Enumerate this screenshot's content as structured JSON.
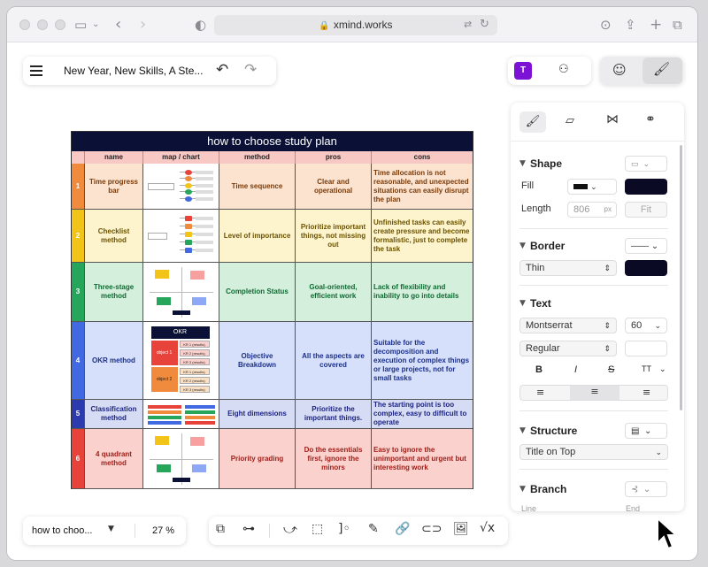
{
  "browser": {
    "url": "xmind.works"
  },
  "toolbar": {
    "doc_title": "New Year, New Skills, A Ste...",
    "user_badge": "T"
  },
  "sheet": {
    "title": "how to choose study plan",
    "headers": [
      "",
      "name",
      "map / chart",
      "method",
      "pros",
      "cons"
    ],
    "rows": [
      {
        "num": "1",
        "name": "Time progress bar",
        "method": "Time sequence",
        "pros": "Clear and operational",
        "cons": "Time allocation is not reasonable, and unexpected situations can easily disrupt the plan"
      },
      {
        "num": "2",
        "name": "Checklist method",
        "method": "Level of importance",
        "pros": "Prioritize important things, not missing out",
        "cons": "Unfinished tasks can easily create pressure and become formalistic, just to complete the task"
      },
      {
        "num": "3",
        "name": "Three-stage method",
        "method": "Completion Status",
        "pros": "Goal-oriented, efficient work",
        "cons": "Lack of flexibility and inability to go into details"
      },
      {
        "num": "4",
        "name": "OKR method",
        "method": "Objective Breakdown",
        "pros": "All the aspects are covered",
        "cons": "Suitable for the decomposition and execution of complex things or large projects, not for small tasks"
      },
      {
        "num": "5",
        "name": "Classification method",
        "method": "Eight dimensions",
        "pros": "Prioritize the important things.",
        "cons": "The starting point is too complex, easy to difficult to operate"
      },
      {
        "num": "6",
        "name": "4 quadrant method",
        "method": "Priority grading",
        "pros": "Do the essentials first, ignore the minors",
        "cons": "Easy to ignore the unimportant and urgent but interesting work"
      }
    ],
    "okr": {
      "title": "OKR",
      "obj1": "object 1",
      "obj2": "object 2",
      "kr": [
        "KR 1 (results)",
        "KR 2 (results)",
        "KR 3 (results)",
        "KR 1 (results)",
        "KR 2 (results)",
        "KR 3 (results)"
      ]
    }
  },
  "colors": {
    "num_bar": [
      "#f08a3c",
      "#f2c318",
      "#26a65b",
      "#4169e1",
      "#2c3cad",
      "#e8433b"
    ],
    "row_bg": [
      "#fbe3cf",
      "#fdf3cc",
      "#d5efdd",
      "#d6e0fb",
      "#d7dcf5",
      "#fbd1cd"
    ],
    "accent": "#7b12d6",
    "swatch": "#0b0a24"
  },
  "right_panel": {
    "tabs": [
      "paint-brush-icon",
      "sticker-icon",
      "map-icon",
      "filter-icon"
    ],
    "shape": {
      "title": "Shape",
      "fill_label": "Fill",
      "length_label": "Length",
      "length_value": "806",
      "length_unit": "px",
      "fit_label": "Fit"
    },
    "border": {
      "title": "Border",
      "weight": "Thin"
    },
    "text": {
      "title": "Text",
      "font": "Montserrat",
      "size": "60",
      "style": "Regular",
      "bold": "B",
      "italic": "I",
      "strike": "S",
      "case": "TT"
    },
    "structure": {
      "title": "Structure",
      "value": "Title on Top"
    },
    "branch": {
      "title": "Branch",
      "line_label": "Line",
      "end_label": "End"
    }
  },
  "bottom_bar": {
    "sheet_name": "how to choo...",
    "zoom": "27 %"
  }
}
